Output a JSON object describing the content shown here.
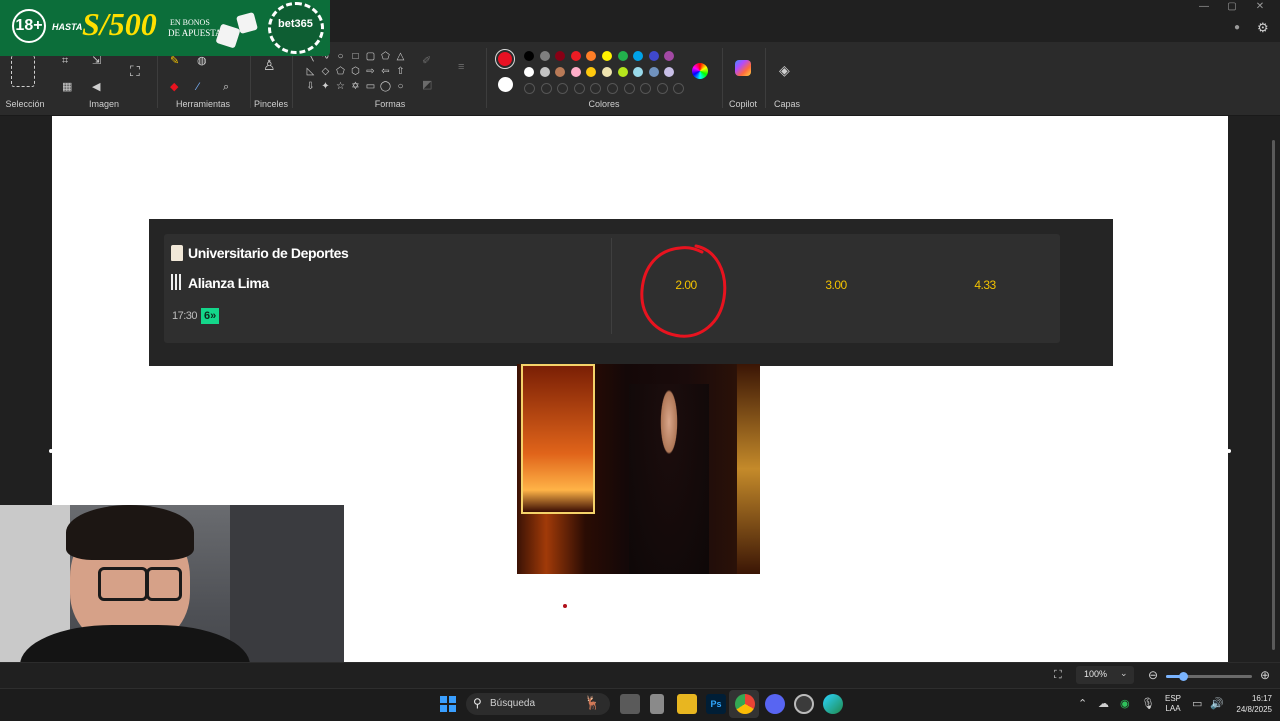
{
  "window": {
    "minimize": "—",
    "maximize": "▢",
    "close": "✕"
  },
  "promo": {
    "age": "18+",
    "prefix": "HASTA",
    "amount": "S/500",
    "line1": "EN BONOS",
    "line2": "DE APUESTA",
    "brand": "bet365"
  },
  "ribbon": {
    "groups": {
      "seleccion": "Selección",
      "imagen": "Imagen",
      "herramientas": "Herramientas",
      "pinceles": "Pinceles",
      "formas": "Formas",
      "colores": "Colores",
      "copilot": "Copilot",
      "capas": "Capas"
    },
    "active_color": "#e81123",
    "secondary_color": "#ffffff",
    "palette_row1": [
      "#000000",
      "#7f7f7f",
      "#880015",
      "#ed1c24",
      "#ff7f27",
      "#fff200",
      "#22b14c",
      "#00a2e8",
      "#3f48cc",
      "#a349a4"
    ],
    "palette_row2": [
      "#ffffff",
      "#c3c3c3",
      "#b97a57",
      "#ffaec9",
      "#ffc90e",
      "#efe4b0",
      "#b5e61d",
      "#99d9ea",
      "#7092be",
      "#c8bfe7"
    ]
  },
  "bet": {
    "home_team": "Universitario de Deportes",
    "away_team": "Alianza Lima",
    "time": "17:30",
    "badge": "6»",
    "odds": [
      "2.00",
      "3.00",
      "4.33"
    ],
    "accent": "#f2c200",
    "circle_color": "#e8131f"
  },
  "statusbar": {
    "zoom": "100%",
    "zoom_fraction": 0.2
  },
  "taskbar": {
    "search_placeholder": "Búsqueda",
    "lang1": "ESP",
    "lang2": "LAA",
    "time": "16:17",
    "date": "24/8/2025"
  }
}
